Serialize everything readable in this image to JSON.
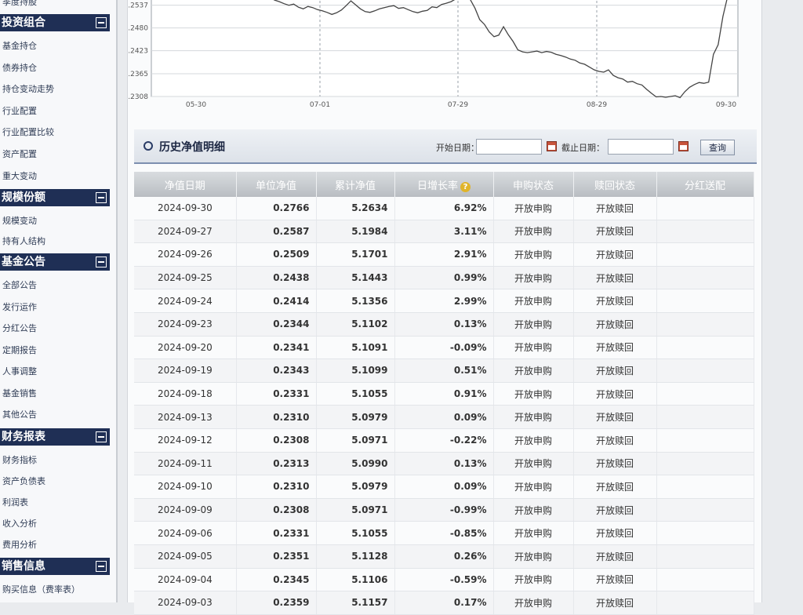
{
  "sidebar": {
    "top_item": "季度持股",
    "sections": [
      {
        "title": "投资组合",
        "items": [
          "基金持仓",
          "债券持仓",
          "持仓变动走势",
          "行业配置",
          "行业配置比较",
          "资产配置",
          "重大变动"
        ]
      },
      {
        "title": "规模份额",
        "items": [
          "规模变动",
          "持有人结构"
        ]
      },
      {
        "title": "基金公告",
        "items": [
          "全部公告",
          "发行运作",
          "分红公告",
          "定期报告",
          "人事调整",
          "基金销售",
          "其他公告"
        ]
      },
      {
        "title": "财务报表",
        "items": [
          "财务指标",
          "资产负债表",
          "利润表",
          "收入分析",
          "费用分析"
        ]
      },
      {
        "title": "销售信息",
        "items": [
          "购买信息（费率表）"
        ]
      }
    ]
  },
  "chart_data": {
    "type": "line",
    "y_ticks": [
      0.2537,
      0.248,
      0.2423,
      0.2365,
      0.2308
    ],
    "x_ticks": [
      "05-30",
      "07-01",
      "07-29",
      "08-29",
      "09-30"
    ],
    "ylim": [
      0.2308,
      0.256
    ],
    "series": [
      {
        "values": [
          0.256,
          0.2556,
          0.255,
          0.2546,
          0.2541,
          0.2537,
          0.254,
          0.2532,
          0.2528,
          0.2534,
          0.2531,
          0.2526,
          0.2523,
          0.2519,
          0.2514,
          0.2518,
          0.2525,
          0.2536,
          0.2548,
          0.2538,
          0.2528,
          0.2521,
          0.2519,
          0.2523,
          0.2528,
          0.2531,
          0.2534,
          0.2536,
          0.2529,
          0.2531,
          0.2526,
          0.2521,
          0.2518,
          0.2522,
          0.2524,
          0.2533,
          0.2531,
          0.2539,
          0.2542,
          0.2546,
          0.2553,
          0.2556,
          0.2558,
          0.2552,
          0.253,
          0.2501,
          0.2489,
          0.247,
          0.2458,
          0.2462,
          0.2483,
          0.2463,
          0.2446,
          0.2425,
          0.242,
          0.2418,
          0.242,
          0.2422,
          0.2418,
          0.2421,
          0.2419,
          0.2414,
          0.2411,
          0.2407,
          0.2402,
          0.2399,
          0.2392,
          0.2389,
          0.2382,
          0.2375,
          0.2371,
          0.2369,
          0.2375,
          0.2361,
          0.2355,
          0.2352,
          0.2344,
          0.2346,
          0.234,
          0.2337,
          0.2326,
          0.2316,
          0.2307,
          0.2308,
          0.2306,
          0.2308,
          0.231,
          0.2305,
          0.232,
          0.2331,
          0.2338,
          0.2343,
          0.2341,
          0.2344,
          0.2414,
          0.2438,
          0.2509,
          0.2587
        ]
      }
    ]
  },
  "panel": {
    "title": "历史净值明细",
    "start_label": "开始日期：",
    "end_label": "截止日期：",
    "start_value": "",
    "end_value": "",
    "query_label": "查询"
  },
  "table": {
    "headers": [
      "净值日期",
      "单位净值",
      "累计净值",
      "日增长率",
      "申购状态",
      "赎回状态",
      "分红送配"
    ],
    "rows": [
      [
        "2024-09-30",
        "0.2766",
        "5.2634",
        "6.92%",
        "开放申购",
        "开放赎回",
        ""
      ],
      [
        "2024-09-27",
        "0.2587",
        "5.1984",
        "3.11%",
        "开放申购",
        "开放赎回",
        ""
      ],
      [
        "2024-09-26",
        "0.2509",
        "5.1701",
        "2.91%",
        "开放申购",
        "开放赎回",
        ""
      ],
      [
        "2024-09-25",
        "0.2438",
        "5.1443",
        "0.99%",
        "开放申购",
        "开放赎回",
        ""
      ],
      [
        "2024-09-24",
        "0.2414",
        "5.1356",
        "2.99%",
        "开放申购",
        "开放赎回",
        ""
      ],
      [
        "2024-09-23",
        "0.2344",
        "5.1102",
        "0.13%",
        "开放申购",
        "开放赎回",
        ""
      ],
      [
        "2024-09-20",
        "0.2341",
        "5.1091",
        "-0.09%",
        "开放申购",
        "开放赎回",
        ""
      ],
      [
        "2024-09-19",
        "0.2343",
        "5.1099",
        "0.51%",
        "开放申购",
        "开放赎回",
        ""
      ],
      [
        "2024-09-18",
        "0.2331",
        "5.1055",
        "0.91%",
        "开放申购",
        "开放赎回",
        ""
      ],
      [
        "2024-09-13",
        "0.2310",
        "5.0979",
        "0.09%",
        "开放申购",
        "开放赎回",
        ""
      ],
      [
        "2024-09-12",
        "0.2308",
        "5.0971",
        "-0.22%",
        "开放申购",
        "开放赎回",
        ""
      ],
      [
        "2024-09-11",
        "0.2313",
        "5.0990",
        "0.13%",
        "开放申购",
        "开放赎回",
        ""
      ],
      [
        "2024-09-10",
        "0.2310",
        "5.0979",
        "0.09%",
        "开放申购",
        "开放赎回",
        ""
      ],
      [
        "2024-09-09",
        "0.2308",
        "5.0971",
        "-0.99%",
        "开放申购",
        "开放赎回",
        ""
      ],
      [
        "2024-09-06",
        "0.2331",
        "5.1055",
        "-0.85%",
        "开放申购",
        "开放赎回",
        ""
      ],
      [
        "2024-09-05",
        "0.2351",
        "5.1128",
        "0.26%",
        "开放申购",
        "开放赎回",
        ""
      ],
      [
        "2024-09-04",
        "0.2345",
        "5.1106",
        "-0.59%",
        "开放申购",
        "开放赎回",
        ""
      ],
      [
        "2024-09-03",
        "0.2359",
        "5.1157",
        "0.17%",
        "开放申购",
        "开放赎回",
        ""
      ]
    ]
  },
  "colors": {
    "up": "#d21c1c",
    "down": "#1e8c2c",
    "line": "#444444",
    "header": "#1f2f55"
  }
}
